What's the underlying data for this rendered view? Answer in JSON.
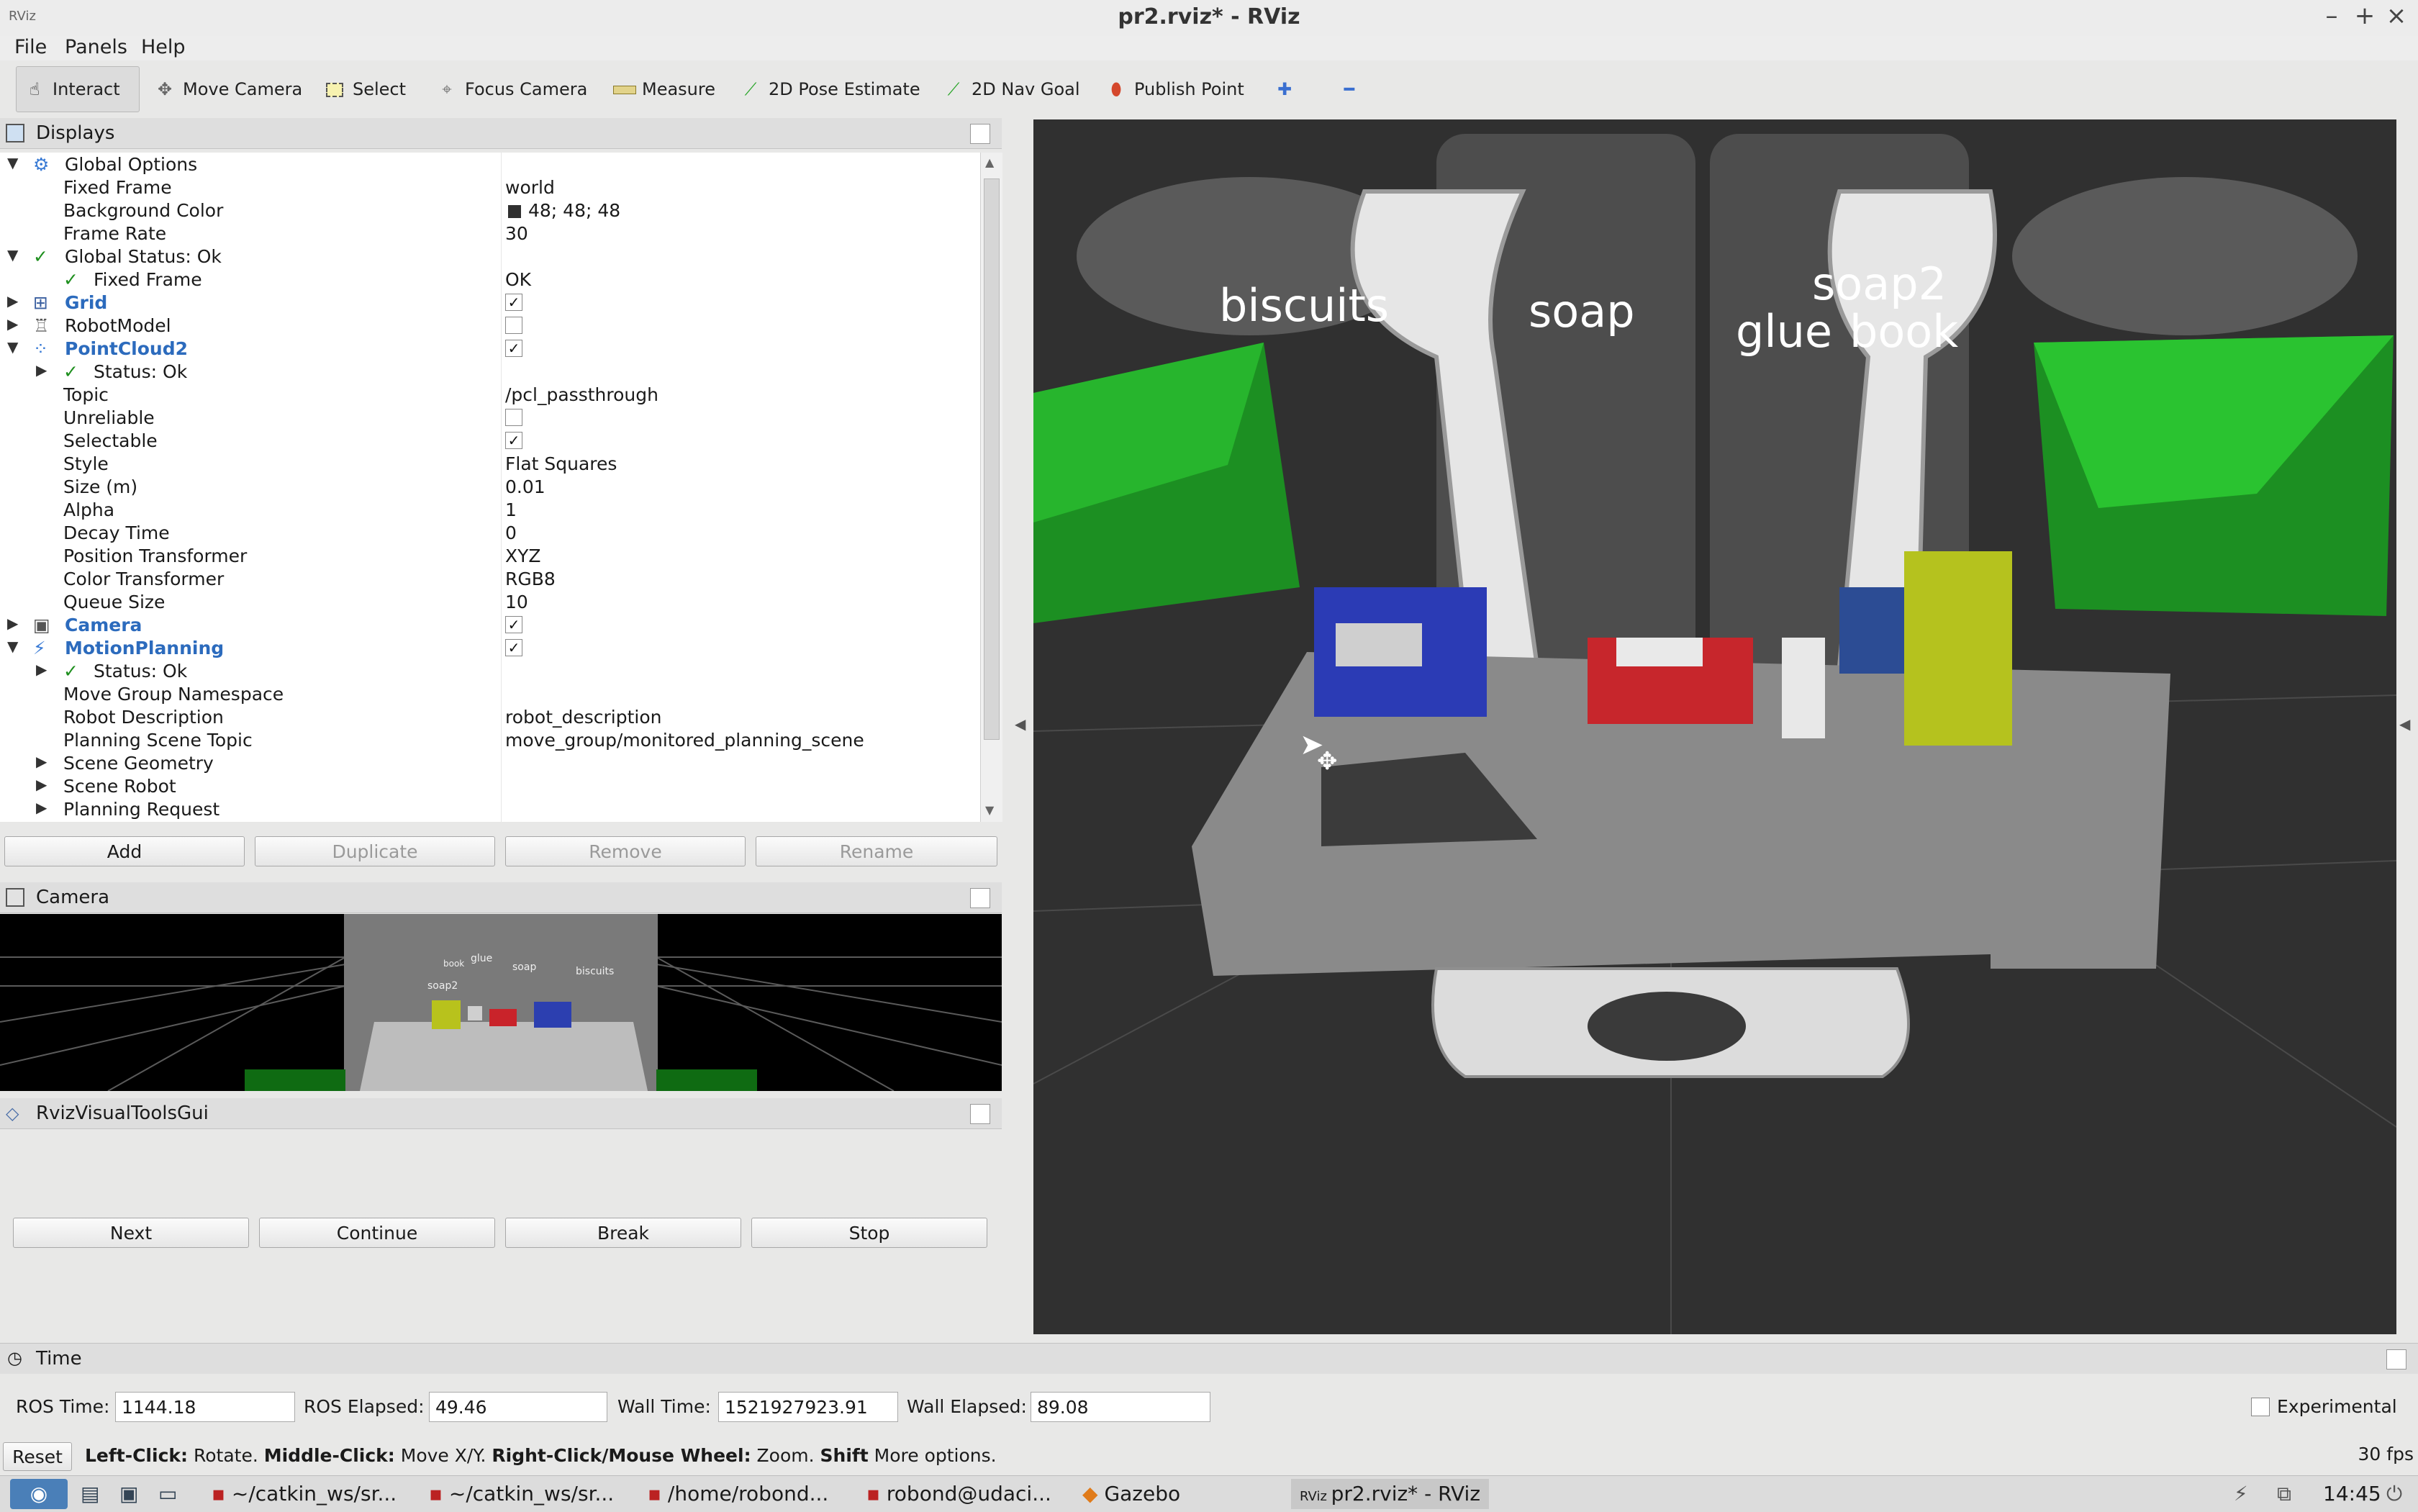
{
  "window": {
    "title": "pr2.rviz* - RViz"
  },
  "menu": [
    "File",
    "Panels",
    "Help"
  ],
  "toolbar": {
    "tools": [
      "Interact",
      "Move Camera",
      "Select",
      "Focus Camera",
      "Measure",
      "2D Pose Estimate",
      "2D Nav Goal",
      "Publish Point"
    ],
    "active": "Interact"
  },
  "displays": {
    "title": "Displays",
    "rows": [
      {
        "label": "Global Options",
        "value": ""
      },
      {
        "label": "Fixed Frame",
        "value": "world"
      },
      {
        "label": "Background Color",
        "value": "48; 48; 48"
      },
      {
        "label": "Frame Rate",
        "value": "30"
      },
      {
        "label": "Global Status: Ok",
        "value": ""
      },
      {
        "label": "Fixed Frame",
        "value": "OK"
      },
      {
        "label": "Grid",
        "value": ""
      },
      {
        "label": "RobotModel",
        "value": ""
      },
      {
        "label": "PointCloud2",
        "value": ""
      },
      {
        "label": "Status: Ok",
        "value": ""
      },
      {
        "label": "Topic",
        "value": "/pcl_passthrough"
      },
      {
        "label": "Unreliable",
        "value": ""
      },
      {
        "label": "Selectable",
        "value": ""
      },
      {
        "label": "Style",
        "value": "Flat Squares"
      },
      {
        "label": "Size (m)",
        "value": "0.01"
      },
      {
        "label": "Alpha",
        "value": "1"
      },
      {
        "label": "Decay Time",
        "value": "0"
      },
      {
        "label": "Position Transformer",
        "value": "XYZ"
      },
      {
        "label": "Color Transformer",
        "value": "RGB8"
      },
      {
        "label": "Queue Size",
        "value": "10"
      },
      {
        "label": "Camera",
        "value": ""
      },
      {
        "label": "MotionPlanning",
        "value": ""
      },
      {
        "label": "Status: Ok",
        "value": ""
      },
      {
        "label": "Move Group Namespace",
        "value": ""
      },
      {
        "label": "Robot Description",
        "value": "robot_description"
      },
      {
        "label": "Planning Scene Topic",
        "value": "move_group/monitored_planning_scene"
      },
      {
        "label": "Scene Geometry",
        "value": ""
      },
      {
        "label": "Scene Robot",
        "value": ""
      },
      {
        "label": "Planning Request",
        "value": ""
      }
    ],
    "background_color_hex": "#303030",
    "buttons": [
      "Add",
      "Duplicate",
      "Remove",
      "Rename"
    ]
  },
  "camera_panel": {
    "title": "Camera",
    "labels": [
      "biscuits",
      "soap",
      "glue",
      "book",
      "soap2"
    ]
  },
  "visual_tools": {
    "title": "RvizVisualToolsGui",
    "buttons": [
      "Next",
      "Continue",
      "Break",
      "Stop"
    ]
  },
  "viewport": {
    "labels": [
      "biscuits",
      "soap",
      "soap2",
      "glue",
      "book"
    ]
  },
  "time": {
    "title": "Time",
    "ros_time_label": "ROS Time:",
    "ros_time": "1144.18",
    "ros_elapsed_label": "ROS Elapsed:",
    "ros_elapsed": "49.46",
    "wall_time_label": "Wall Time:",
    "wall_time": "1521927923.91",
    "wall_elapsed_label": "Wall Elapsed:",
    "wall_elapsed": "89.08",
    "experimental": "Experimental"
  },
  "status": {
    "reset": "Reset",
    "left_click": "Left-Click:",
    "left_click_desc": "Rotate.",
    "middle_click": "Middle-Click:",
    "middle_click_desc": "Move X/Y.",
    "right_click": "Right-Click/Mouse Wheel:",
    "right_click_desc": "Zoom.",
    "shift": "Shift",
    "shift_desc": "More options.",
    "fps": "30 fps"
  },
  "taskbar": {
    "items": [
      "~/catkin_ws/sr...",
      "~/catkin_ws/sr...",
      "/home/robond...",
      "robond@udaci...",
      "Gazebo",
      "pr2.rviz* - RViz"
    ],
    "clock": "14:45"
  }
}
